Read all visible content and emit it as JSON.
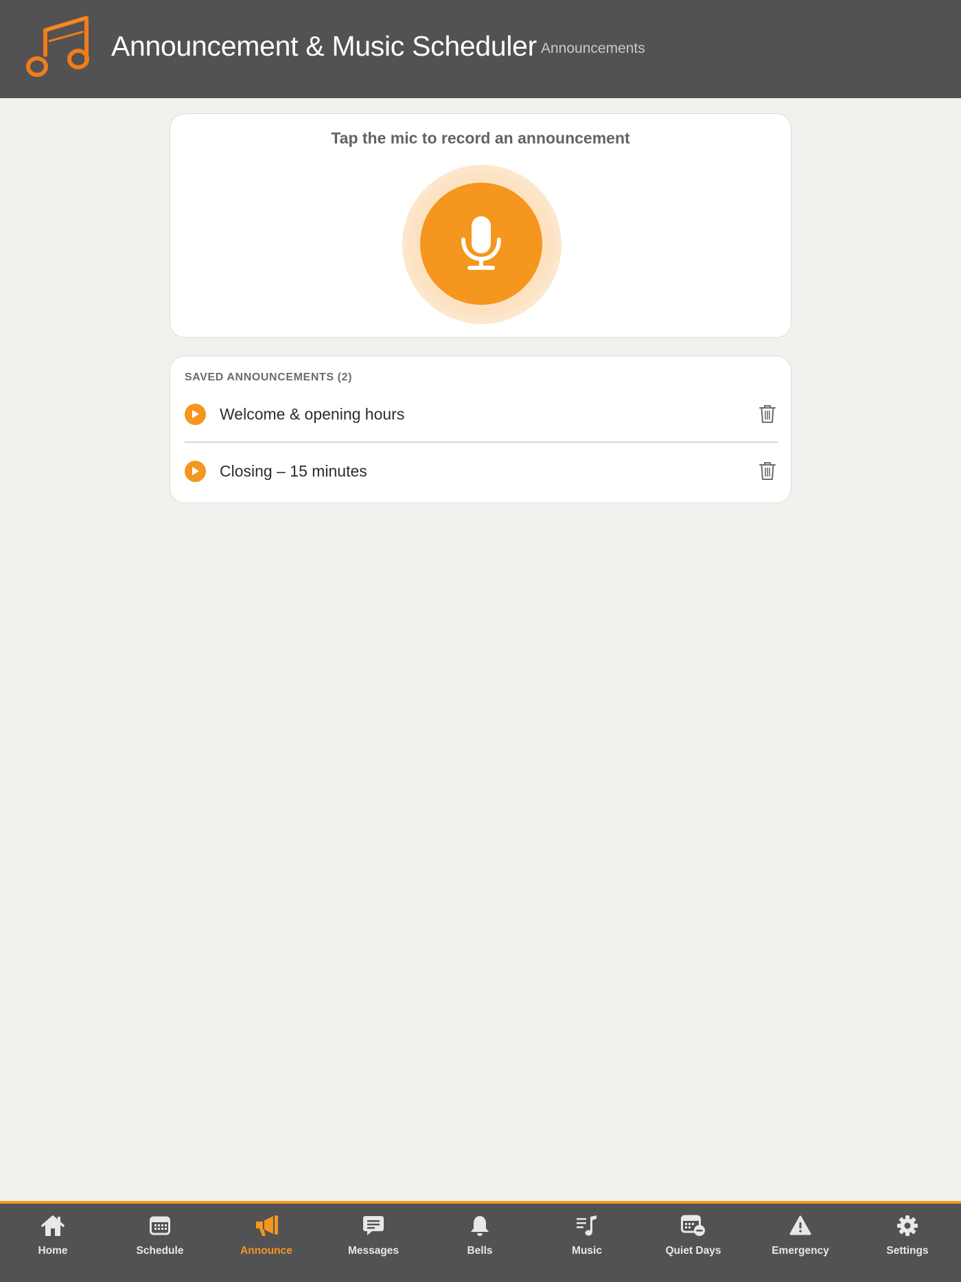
{
  "header": {
    "title": "Announcement & Music Scheduler",
    "breadcrumb": "Announcements",
    "logo_icon": "music-note-icon"
  },
  "record": {
    "prompt": "Tap the mic to record an announcement",
    "mic_icon": "microphone-icon"
  },
  "saved": {
    "header": "SAVED ANNOUNCEMENTS (2)",
    "items": [
      {
        "title": "Welcome & opening hours"
      },
      {
        "title": "Closing – 15 minutes"
      }
    ]
  },
  "tabs": [
    {
      "label": "Home",
      "icon": "home-icon",
      "active": false
    },
    {
      "label": "Schedule",
      "icon": "calendar-icon",
      "active": false
    },
    {
      "label": "Announce",
      "icon": "megaphone-icon",
      "active": true
    },
    {
      "label": "Messages",
      "icon": "message-icon",
      "active": false
    },
    {
      "label": "Bells",
      "icon": "bell-icon",
      "active": false
    },
    {
      "label": "Music",
      "icon": "music-list-icon",
      "active": false
    },
    {
      "label": "Quiet Days",
      "icon": "calendar-minus-icon",
      "active": false
    },
    {
      "label": "Emergency",
      "icon": "warning-icon",
      "active": false
    },
    {
      "label": "Settings",
      "icon": "gear-icon",
      "active": false
    }
  ],
  "colors": {
    "accent": "#f5961e",
    "header_bg": "#525254",
    "page_bg": "#f2f1ee"
  }
}
